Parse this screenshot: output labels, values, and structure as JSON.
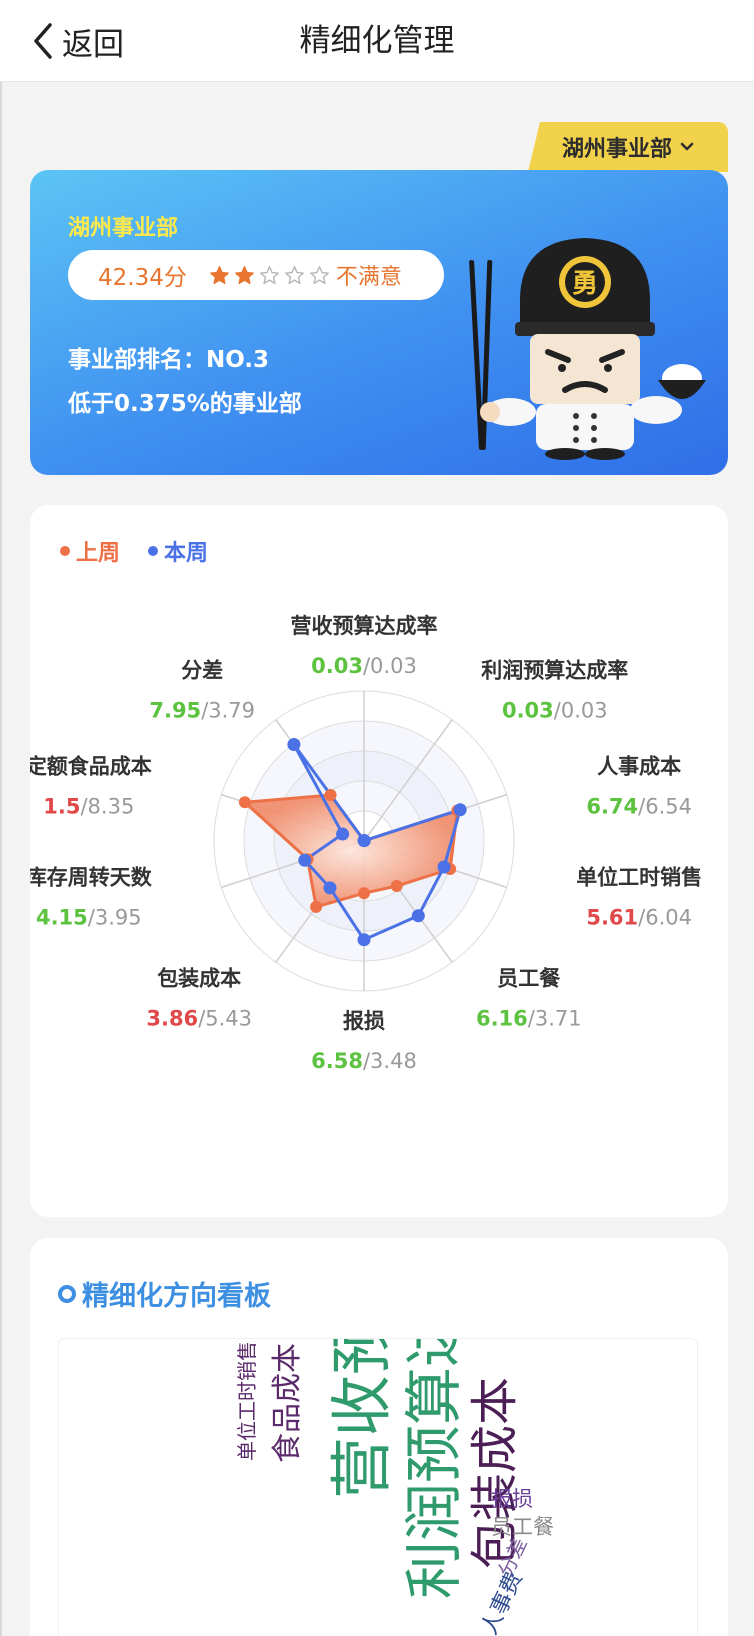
{
  "nav": {
    "back_label": "返回",
    "title": "精细化管理"
  },
  "dept_selector": {
    "label": "湖州事业部"
  },
  "summary": {
    "dept_name": "湖州事业部",
    "score": "42.34分",
    "stars_filled": 2,
    "stars_total": 5,
    "level": "不满意",
    "rank": "事业部排名：NO.3",
    "below": "低于0.375%的事业部"
  },
  "radar": {
    "legend": [
      {
        "label": "上周",
        "color": "#ee7046"
      },
      {
        "label": "本周",
        "color": "#4a72e6"
      }
    ],
    "axes": [
      {
        "name": "营收预算达成率",
        "current": "0.03",
        "previous": "0.03",
        "status": "good"
      },
      {
        "name": "利润预算达成率",
        "current": "0.03",
        "previous": "0.03",
        "status": "good"
      },
      {
        "name": "人事成本",
        "current": "6.74",
        "previous": "6.54",
        "status": "good"
      },
      {
        "name": "单位工时销售",
        "current": "5.61",
        "previous": "6.04",
        "status": "bad"
      },
      {
        "name": "员工餐",
        "current": "6.16",
        "previous": "3.71",
        "status": "good"
      },
      {
        "name": "报损",
        "current": "6.58",
        "previous": "3.48",
        "status": "good"
      },
      {
        "name": "包装成本",
        "current": "3.86",
        "previous": "5.43",
        "status": "bad"
      },
      {
        "name": "库存周转天数",
        "current": "4.15",
        "previous": "3.95",
        "status": "good"
      },
      {
        "name": "定额食品成本",
        "current": "1.5",
        "previous": "8.35",
        "status": "bad"
      },
      {
        "name": "分差",
        "current": "7.95",
        "previous": "3.79",
        "status": "good"
      }
    ],
    "status_colors": {
      "good": "#5cc23f",
      "bad": "#e0484a",
      "neutral": "#999999"
    },
    "series": [
      {
        "name": "上周",
        "color": "#ee7046",
        "values": [
          0.03,
          0.03,
          6.54,
          6.04,
          3.71,
          3.48,
          5.43,
          3.95,
          8.35,
          3.79
        ]
      },
      {
        "name": "本周",
        "color": "#4a72e6",
        "values": [
          0.03,
          0.03,
          6.74,
          5.61,
          6.16,
          6.58,
          3.86,
          4.15,
          1.5,
          7.95
        ]
      }
    ],
    "max": 10
  },
  "board": {
    "title": "精细化方向看板",
    "words": [
      {
        "text": "营收预算达成率",
        "color": "#2f9a6c"
      },
      {
        "text": "利润预算达成率",
        "color": "#2f9a6c"
      },
      {
        "text": "包装成本",
        "color": "#4b1f56"
      },
      {
        "text": "食品成本",
        "color": "#5b2a6b"
      },
      {
        "text": "单位工时销售",
        "color": "#5b2a6b"
      },
      {
        "text": "报损",
        "color": "#6a3f9a"
      },
      {
        "text": "员工餐",
        "color": "#8a8a8a"
      },
      {
        "text": "分差",
        "color": "#7d5fa0"
      },
      {
        "text": "人事费",
        "color": "#2d4a8e"
      }
    ]
  }
}
